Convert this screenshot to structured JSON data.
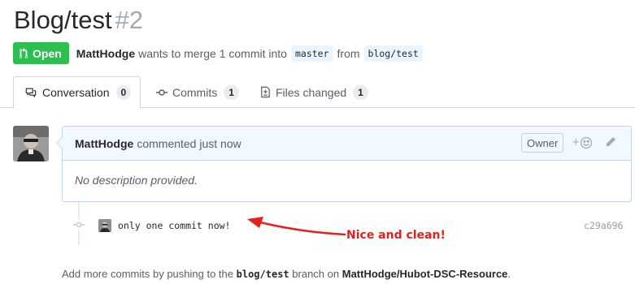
{
  "pull_request": {
    "title": "Blog/test",
    "number": "#2",
    "state": "Open",
    "author": "MattHodge",
    "summary_text": "wants to merge 1 commit into",
    "base_branch": "master",
    "from_text": "from",
    "head_branch": "blog/test"
  },
  "tabs": [
    {
      "label": "Conversation",
      "count": "0",
      "icon": "comment-discussion-icon",
      "selected": true
    },
    {
      "label": "Commits",
      "count": "1",
      "icon": "git-commit-icon",
      "selected": false
    },
    {
      "label": "Files changed",
      "count": "1",
      "icon": "file-diff-icon",
      "selected": false
    }
  ],
  "comment": {
    "author": "MattHodge",
    "action_text": "commented just now",
    "owner_label": "Owner",
    "reaction_label": "+",
    "body": "No description provided."
  },
  "commit": {
    "message": "only one commit now!",
    "sha": "c29a696"
  },
  "annotation": {
    "text": "Nice and clean!",
    "color": "#e8201a"
  },
  "footer": {
    "prefix": "Add more commits by pushing to the",
    "branch": "blog/test",
    "middle": "branch on",
    "repo": "MattHodge/Hubot-DSC-Resource",
    "suffix": "."
  },
  "colors": {
    "open_badge": "#2cbe4e",
    "comment_header_bg": "#f1f8ff",
    "comment_border": "#c0d3eb",
    "branch_bg": "#eaf5ff"
  }
}
